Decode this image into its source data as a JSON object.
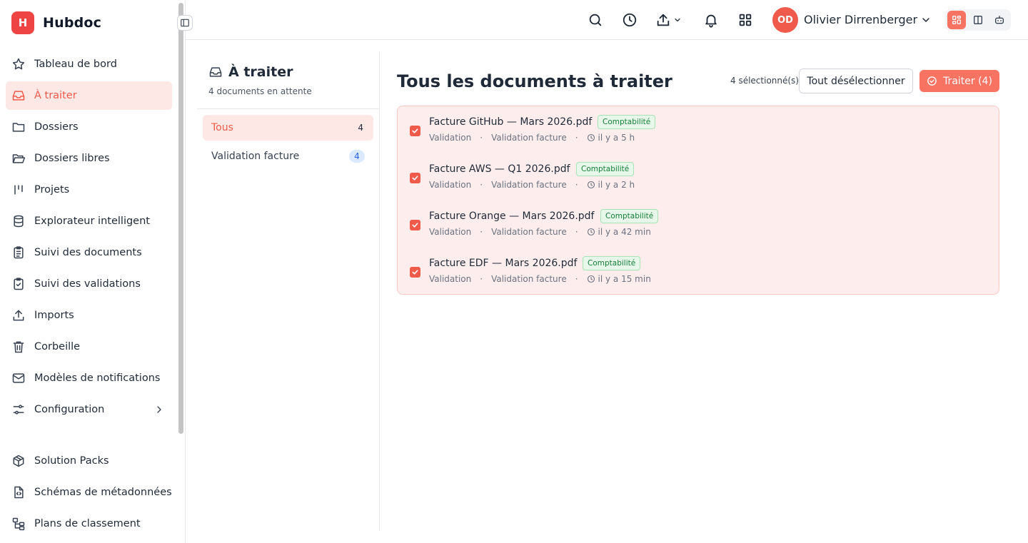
{
  "brand": {
    "logo_letter": "H",
    "name": "Hubdoc",
    "accent": "#ef4444"
  },
  "sidebar": {
    "items": [
      {
        "label": "Tableau de bord",
        "icon": "star-icon",
        "active": false
      },
      {
        "label": "À traiter",
        "icon": "inbox-icon",
        "active": true
      },
      {
        "label": "Dossiers",
        "icon": "folder-icon",
        "active": false
      },
      {
        "label": "Dossiers libres",
        "icon": "folder-open-icon",
        "active": false
      },
      {
        "label": "Projets",
        "icon": "kanban-icon",
        "active": false
      },
      {
        "label": "Explorateur intelligent",
        "icon": "database-icon",
        "active": false
      },
      {
        "label": "Suivi des documents",
        "icon": "clipboard-list-icon",
        "active": false
      },
      {
        "label": "Suivi des validations",
        "icon": "clipboard-check-icon",
        "active": false
      },
      {
        "label": "Imports",
        "icon": "upload-icon",
        "active": false
      },
      {
        "label": "Corbeille",
        "icon": "trash-icon",
        "active": false
      },
      {
        "label": "Modèles de notifications",
        "icon": "mail-icon",
        "active": false
      },
      {
        "label": "Configuration",
        "icon": "sliders-icon",
        "active": false
      }
    ],
    "bottom_items": [
      {
        "label": "Solution Packs",
        "icon": "package-icon"
      },
      {
        "label": "Schémas de métadonnées",
        "icon": "file-code-icon"
      },
      {
        "label": "Plans de classement",
        "icon": "hierarchy-icon"
      }
    ]
  },
  "topbar": {
    "user": {
      "initials": "OD",
      "name": "Olivier Dirrenberger"
    }
  },
  "queue": {
    "title": "À traiter",
    "subtitle": "4 documents en attente",
    "filters": [
      {
        "label": "Tous",
        "count": "4",
        "active": true
      },
      {
        "label": "Validation facture",
        "count": "4",
        "active": false
      }
    ]
  },
  "main": {
    "title": "Tous les documents à traiter",
    "selected_count": "4 sélectionné(s)",
    "deselect_label": "Tout désélectionner",
    "process_label": "Traiter (4)",
    "documents": [
      {
        "name": "Facture GitHub — Mars 2026.pdf",
        "tag": "Comptabilité",
        "type": "Validation",
        "workflow": "Validation facture",
        "time": "il y a 5 h",
        "checked": true
      },
      {
        "name": "Facture AWS — Q1 2026.pdf",
        "tag": "Comptabilité",
        "type": "Validation",
        "workflow": "Validation facture",
        "time": "il y a 2 h",
        "checked": true
      },
      {
        "name": "Facture Orange — Mars 2026.pdf",
        "tag": "Comptabilité",
        "type": "Validation",
        "workflow": "Validation facture",
        "time": "il y a 42 min",
        "checked": true
      },
      {
        "name": "Facture EDF — Mars 2026.pdf",
        "tag": "Comptabilité",
        "type": "Validation",
        "workflow": "Validation facture",
        "time": "il y a 15 min",
        "checked": true
      }
    ]
  },
  "colors": {
    "accent": "#ef5a4a",
    "active_bg": "#fde8e6",
    "tag_green": "#16803a"
  }
}
